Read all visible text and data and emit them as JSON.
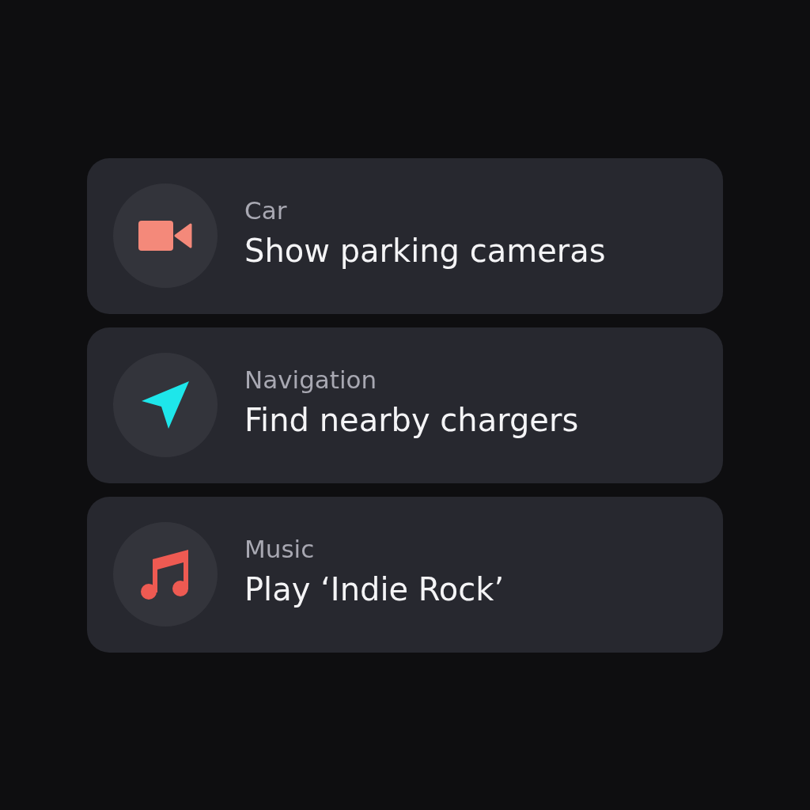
{
  "suggestions": [
    {
      "kind": "camera",
      "color": "#f4897a",
      "category": "Car",
      "action": "Show parking cameras"
    },
    {
      "kind": "navigation",
      "color": "#1ee6ea",
      "category": "Navigation",
      "action": "Find nearby chargers"
    },
    {
      "kind": "music",
      "color": "#ee5a52",
      "category": "Music",
      "action": "Play ‘Indie Rock’"
    }
  ]
}
